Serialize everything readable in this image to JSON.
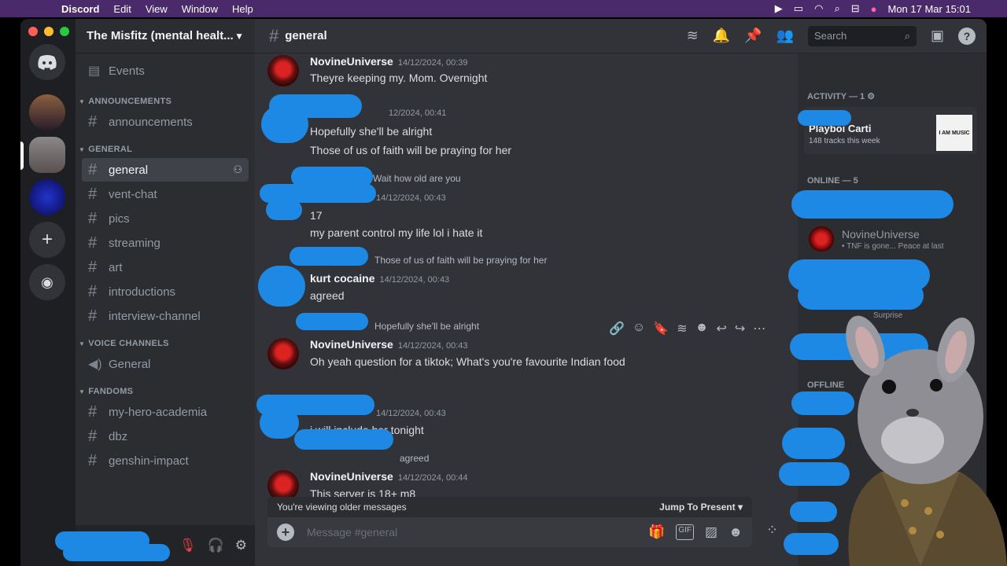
{
  "menubar": {
    "app": "Discord",
    "items": [
      "Edit",
      "View",
      "Window",
      "Help"
    ],
    "datetime": "Mon 17 Mar  15:01"
  },
  "server": {
    "name": "The Misfitz (mental healt...",
    "events": "Events",
    "categories": [
      {
        "name": "ANNOUNCEMENTS",
        "channels": [
          "announcements"
        ]
      },
      {
        "name": "GENERAL",
        "channels": [
          "general",
          "vent-chat",
          "pics",
          "streaming",
          "art",
          "introductions",
          "interview-channel"
        ]
      },
      {
        "name": "VOICE CHANNELS",
        "channels": [
          "General"
        ]
      },
      {
        "name": "FANDOMS",
        "channels": [
          "my-hero-academia",
          "dbz",
          "genshin-impact"
        ]
      }
    ]
  },
  "channel": {
    "title": "general",
    "search_placeholder": "Search"
  },
  "messages": [
    {
      "user": "NovineUniverse",
      "time": "14/12/2024, 00:39",
      "lines": [
        "Theyre keeping my. Mom. Overnight"
      ]
    },
    {
      "user": "",
      "time": "12/2024, 00:41",
      "lines": [
        "Hopefully she'll be alright",
        "Those of us of faith will be praying for her"
      ]
    },
    {
      "reply": "Wait how old are you",
      "user": "",
      "time": "14/12/2024, 00:43",
      "lines": [
        "17",
        "my parent control my life lol i hate it"
      ]
    },
    {
      "reply": "Those of us of faith will be praying for her",
      "user": "kurt cocaine",
      "time": "14/12/2024, 00:43",
      "lines": [
        "agreed"
      ]
    },
    {
      "reply": "Hopefully she'll be alright",
      "user": "NovineUniverse",
      "time": "14/12/2024, 00:43",
      "lines": [
        "Oh yeah question for a tiktok; What's you're favourite Indian food"
      ]
    },
    {
      "user": "",
      "time": "14/12/2024, 00:43",
      "lines": [
        "i will include her tonight"
      ]
    },
    {
      "reply": "agreed",
      "user": "NovineUniverse",
      "time": "14/12/2024, 00:44",
      "lines": [
        "This server is 18+ m8"
      ]
    }
  ],
  "composer": {
    "older_notice": "You're viewing older messages",
    "jump": "Jump To Present",
    "placeholder": "Message #general"
  },
  "members": {
    "activity_header": "ACTIVITY — 1",
    "activity_title": "Playboi Carti",
    "activity_sub": "148 tracks this week",
    "activity_art": "I AM MUSIC",
    "online_header": "ONLINE — 5",
    "online_name": "NovineUniverse",
    "online_status": "• TNF is gone... Peace at last",
    "partial_status": "Surprise",
    "offline_header": "OFFLINE"
  },
  "colors": {
    "blob": "#1e88e5",
    "accent": "#5865f2"
  }
}
